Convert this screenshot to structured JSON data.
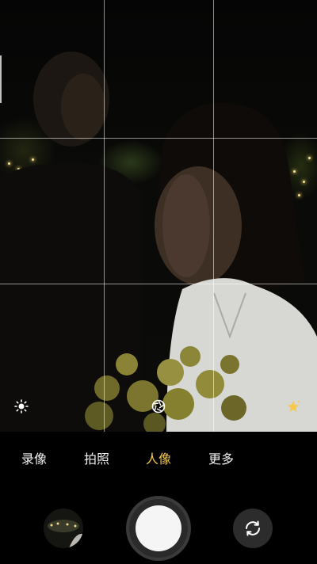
{
  "modes": [
    {
      "label": "录像",
      "active": false
    },
    {
      "label": "拍照",
      "active": false
    },
    {
      "label": "人像",
      "active": true
    },
    {
      "label": "更多",
      "active": false
    }
  ],
  "icons": {
    "exposure": "sun-icon",
    "aperture": "aperture-icon",
    "beauty": "sparkle-star-icon",
    "switch_camera": "switch-camera-icon"
  },
  "colors": {
    "active_mode": "#f7c948",
    "inactive_mode": "#f2f2f2",
    "shutter": "#f5f5f5"
  }
}
